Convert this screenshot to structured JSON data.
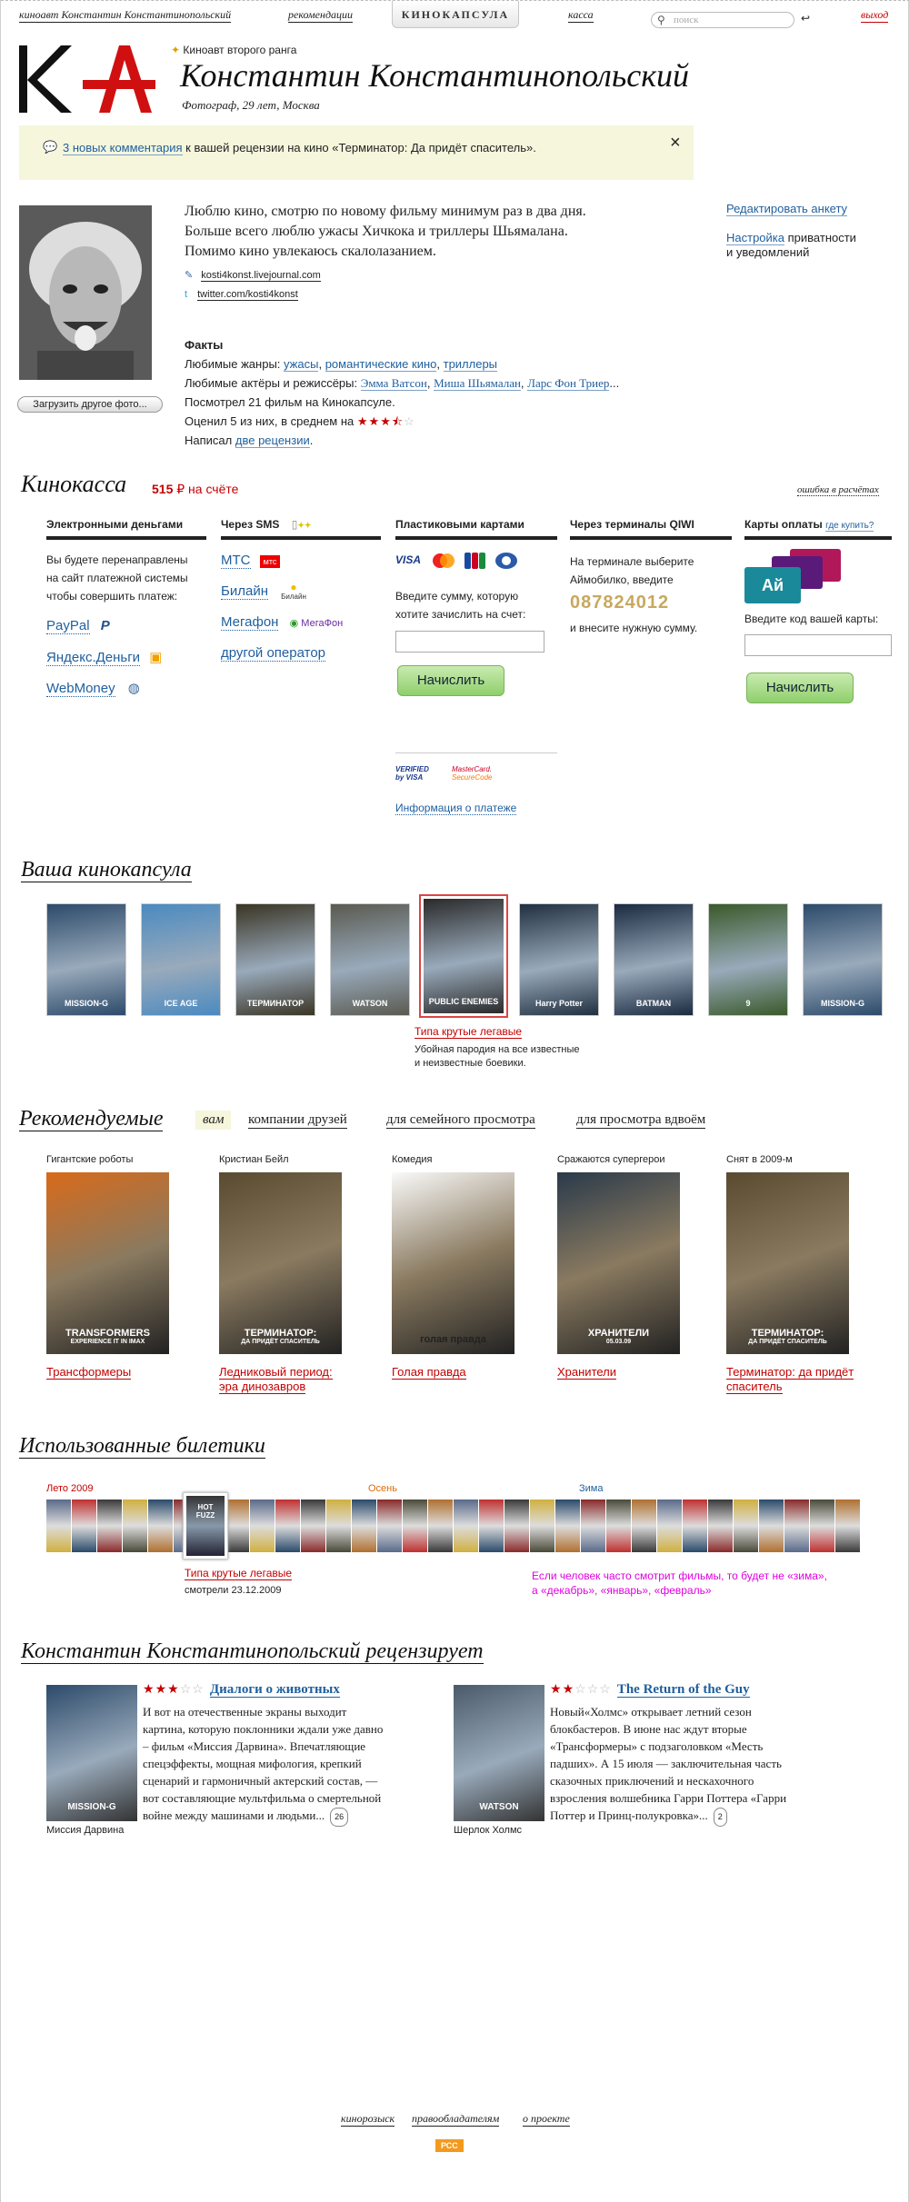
{
  "top": {
    "nav_left": "киноавт Константин Константинопольский",
    "nav_recs": "рекомендации",
    "logo_tab": "КИНОКАПСУЛА",
    "nav_kassa": "касса",
    "search_placeholder": "поиск",
    "logout": "выход"
  },
  "profile": {
    "rank": "Киноавт второго ранга",
    "name": "Константин Константинопольский",
    "subtitle": "Фотограф, 29 лет, Москва",
    "upload": "Загрузить другое фото...",
    "bio": [
      "Люблю кино, смотрю по новому фильму минимум раз в два дня.",
      "Больше всего люблю ужасы Хичкока и триллеры Шьямалана.",
      "Помимо кино увлекаюсь скалолазанием."
    ],
    "lj": "kosti4konst.livejournal.com",
    "twitter": "twitter.com/kosti4konst",
    "edit": "Редактировать анкету",
    "settings_link": "Настройка",
    "settings_rest": "приватности",
    "settings_rest2": "и уведомлений"
  },
  "notice": {
    "link": "3 новых комментария",
    "text": "к вашей рецензии на кино «Терминатор: Да придёт спаситель».",
    "close": "×"
  },
  "facts": {
    "title": "Факты",
    "genres_label": "Любимые жанры:",
    "genres": [
      "ужасы",
      "романтические кино",
      "триллеры"
    ],
    "people_label": "Любимые актёры и режиссёры:",
    "people": [
      "Эмма Ватсон",
      "Миша Шьямалан",
      "Ларс Фон Триер"
    ],
    "ellipsis": "...",
    "watched": "Посмотрел 21 фильм на Кинокапсуле.",
    "rated": "Оценил 5 из них, в среднем на",
    "wrote": "Написал",
    "reviews_link": "две рецензии",
    "dot": "."
  },
  "kassa": {
    "title": "Кинокасса",
    "balance": "515",
    "balance_unit": "₽ на счёте",
    "error": "ошибка в расчётах",
    "col1": {
      "head": "Электронными деньгами",
      "text": [
        "Вы будете перенаправлены",
        "на сайт платежной системы",
        "чтобы совершить платеж:"
      ],
      "items": [
        "PayPal",
        "Яндекс.Деньги",
        "WebMoney"
      ]
    },
    "col2": {
      "head": "Через SMS",
      "items": [
        "МТС",
        "Билайн",
        "Мегафон",
        "другой оператор"
      ],
      "logo_mts": "мтс",
      "logo_mf": "МегаФон",
      "logo_bee": "Билайн"
    },
    "col3": {
      "head": "Пластиковыми картами",
      "cards": [
        "VISA",
        "MC",
        "JCB",
        "D"
      ],
      "text": [
        "Введите сумму, которую",
        "хотите зачислить на счет:"
      ],
      "button": "Начислить",
      "vbv1": "VERIFIED",
      "vbv2": "by VISA",
      "msc1": "MasterCard.",
      "msc2": "SecureCode",
      "info": "Информация о платеже"
    },
    "col4": {
      "head": "Через терминалы QIWI",
      "text": [
        "На терминале выберите",
        "Аймобилко, введите"
      ],
      "code": "087824012",
      "text2": "и внесите нужную сумму."
    },
    "col5": {
      "head": "Карты оплаты",
      "buy": "где купить?",
      "text": "Введите код вашей карты:",
      "button": "Начислить",
      "card": "Ай"
    }
  },
  "capsule": {
    "title": "Ваша кинокапсула",
    "active_title": "Типа крутые легавые",
    "active_desc": [
      "Убойная пародия на все известные",
      "и неизвестные боевики."
    ],
    "posters": [
      "MISSION-G",
      "ICE AGE",
      "ТЕРМИНАТОР",
      "WATSON",
      "PUBLIC ENEMIES",
      "Harry Potter",
      "BATMAN",
      "9",
      "MISSION-G"
    ]
  },
  "recs": {
    "title": "Рекомендуемые",
    "tabs": [
      "вам",
      "компании друзей",
      "для семейного просмотра",
      "для просмотра вдвоём"
    ],
    "items": [
      {
        "cat": "Гигантские роботы",
        "title": "Трансформеры",
        "title2": "",
        "poster": "TRANSFORMERS",
        "sub": "EXPERIENCE IT IN IMAX"
      },
      {
        "cat": "Кристиан Бейл",
        "title": "Ледниковый период:",
        "title2": "эра динозавров",
        "poster": "ТЕРМИНАТОР:",
        "sub": "ДА ПРИДЁТ СПАСИТЕЛЬ"
      },
      {
        "cat": "Комедия",
        "title": "Голая правда",
        "title2": "",
        "poster": "голая правда",
        "sub": ""
      },
      {
        "cat": "Сражаются супергерои",
        "title": "Хранители",
        "title2": "",
        "poster": "ХРАНИТЕЛИ",
        "sub": "05.03.09"
      },
      {
        "cat": "Снят в 2009-м",
        "title": "Терминатор: да придёт",
        "title2": "спаситель",
        "poster": "ТЕРМИНАТОР:",
        "sub": "ДА ПРИДЁТ СПАСИТЕЛЬ"
      }
    ]
  },
  "tickets": {
    "title": "Использованные билетики",
    "s1": "Лето 2009",
    "s2": "Осень",
    "s3": "Зима",
    "active_title": "Типа крутые легавые",
    "active_date": "смотрели 23.12.2009",
    "hint": [
      "Если человек часто смотрит фильмы, то будет не «зима»,",
      "а «декабрь», «январь», «февраль»"
    ]
  },
  "reviews": {
    "title": "Константин Константинопольский рецензирует",
    "items": [
      {
        "stars": 3,
        "title": "Диалоги о животных",
        "text": [
          "И вот на отечественные экраны выходит",
          "картина, которую поклонники ждали уже давно",
          "– фильм «Миссия Дарвина». Впечатляющие",
          "спецэффекты, мощная мифология, крепкий",
          "сценарий и гармоничный актерский состав, —",
          "вот составляющие мультфильма о смертельной",
          "войне между машинами и людьми..."
        ],
        "count": "26",
        "caption": "Миссия Дарвина",
        "poster": "MISSION-G"
      },
      {
        "stars": 2,
        "title": "The Return of the Guy",
        "text": [
          "Новый«Холмс» открывает летний сезон",
          "блокбастеров. В июне нас ждут вторые",
          "«Трансформеры» с подзаголовком «Месть",
          "падших». А 15 июля — заключительная часть",
          "сказочных приключений и нескахочного",
          "взросления волшебника Гарри Поттера «Гарри",
          "Поттер и Принц-полукровка»..."
        ],
        "count": "2",
        "caption": "Шерлок Холмс",
        "poster": "WATSON"
      }
    ]
  },
  "footer": {
    "links": [
      "кинорозыск",
      "правообладателям",
      "о проекте"
    ],
    "rss": "РСС"
  },
  "colors": {
    "accent_red": "#c40000",
    "link": "#1f5f9e",
    "notice_bg": "#f5f6dc",
    "hint_magenta": "#e000e0"
  }
}
